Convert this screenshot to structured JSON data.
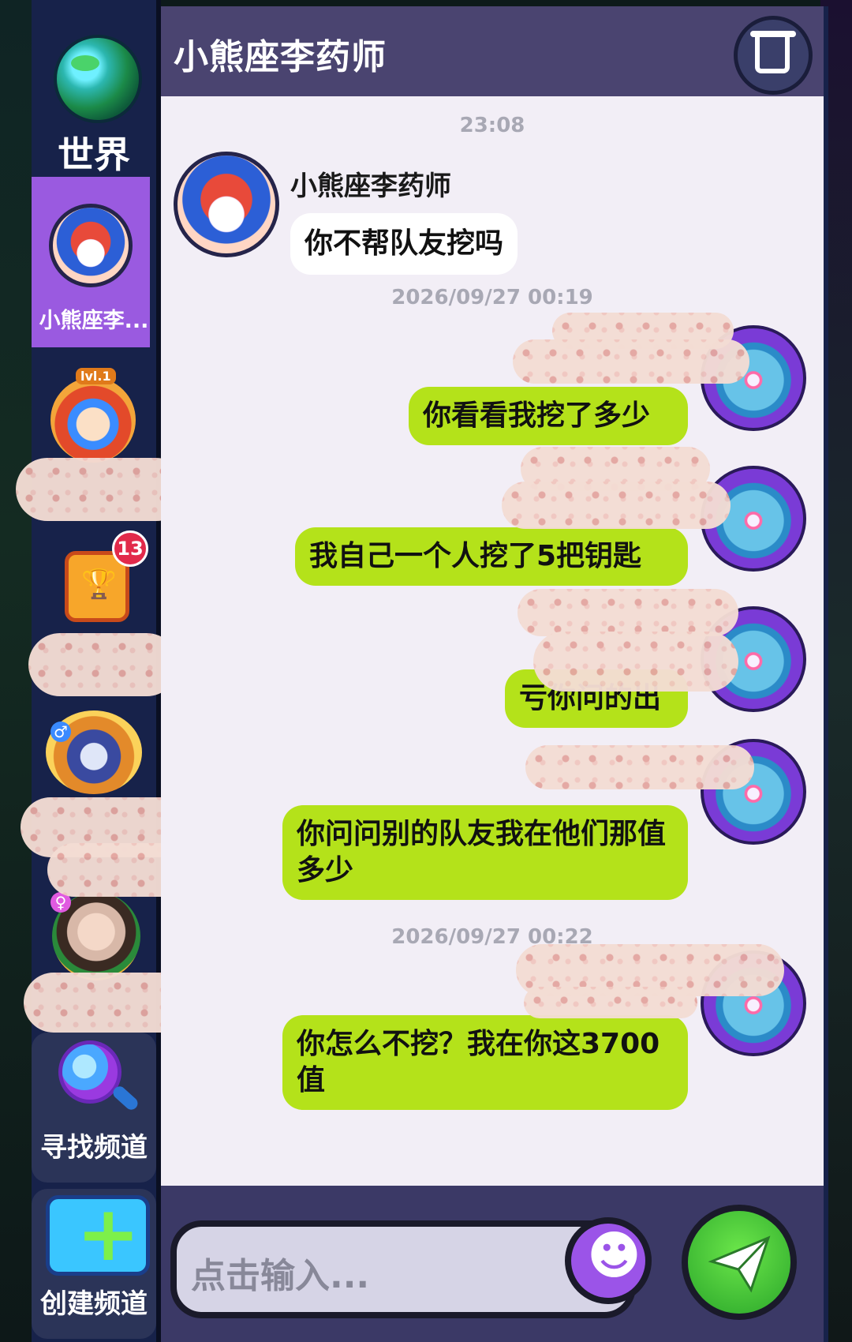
{
  "sidebar": {
    "world_label": "世界",
    "active_label": "小熊座李...",
    "lvl_badge": "lvl.1",
    "notification_count": "13",
    "search_channel_label": "寻找频道",
    "create_channel_label": "创建频道"
  },
  "chat": {
    "title": "小熊座李药师",
    "messages": [
      {
        "time": "23:08"
      },
      {
        "sender": "小熊座李药师",
        "text": "你不帮队友挖吗"
      },
      {
        "time": "2026/09/27 00:19"
      },
      {
        "text": "你看看我挖了多少"
      },
      {
        "text": "我自己一个人挖了5把钥匙"
      },
      {
        "text": "亏你问的出"
      },
      {
        "text": "你问问别的队友我在他们那值多少"
      },
      {
        "time": "2026/09/27 00:22"
      },
      {
        "text": "你怎么不挖？我在你这3700值"
      }
    ]
  },
  "input": {
    "placeholder": "点击输入..."
  },
  "colors": {
    "accent_purple": "#9a5ae0",
    "bubble_green": "#b4e21a",
    "header": "#4a4470"
  },
  "icons": [
    "globe-icon",
    "trophy-icon",
    "trash-icon",
    "search-icon",
    "plus-icon",
    "emoji-icon",
    "send-icon"
  ]
}
